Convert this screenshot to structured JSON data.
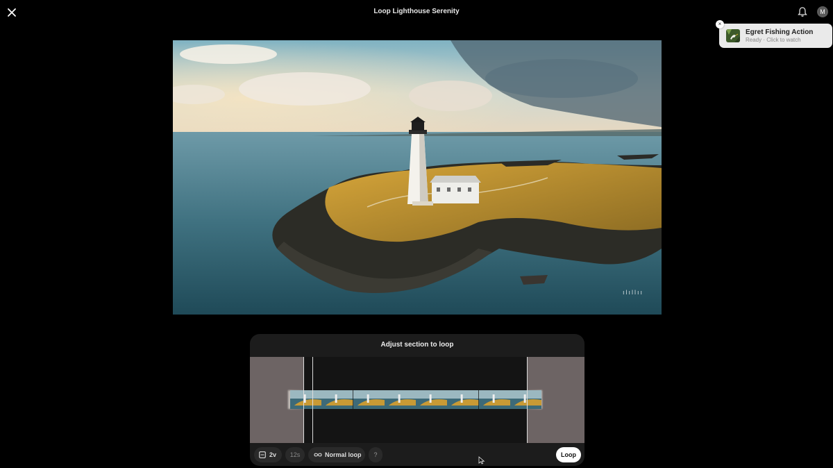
{
  "header": {
    "title": "Loop Lighthouse Serenity",
    "avatar_initial": "M",
    "icons": {
      "close": "close-icon",
      "bell": "bell-icon"
    }
  },
  "toast": {
    "title": "Egret Fishing Action",
    "subtitle": "Ready · Click to watch",
    "close_glyph": "×"
  },
  "video": {
    "watermark": "ılıllıı"
  },
  "loop_panel": {
    "title": "Adjust section to loop",
    "controls": {
      "version_label": "2v",
      "duration_label": "12s",
      "mode_label": "Normal loop",
      "help_label": "?",
      "loop_button": "Loop"
    }
  },
  "colors": {
    "accent": "#ffffff",
    "panel_bg": "#1c1c1c",
    "dimmed_region": "#6d6464",
    "toast_bg": "#eaeaea"
  }
}
